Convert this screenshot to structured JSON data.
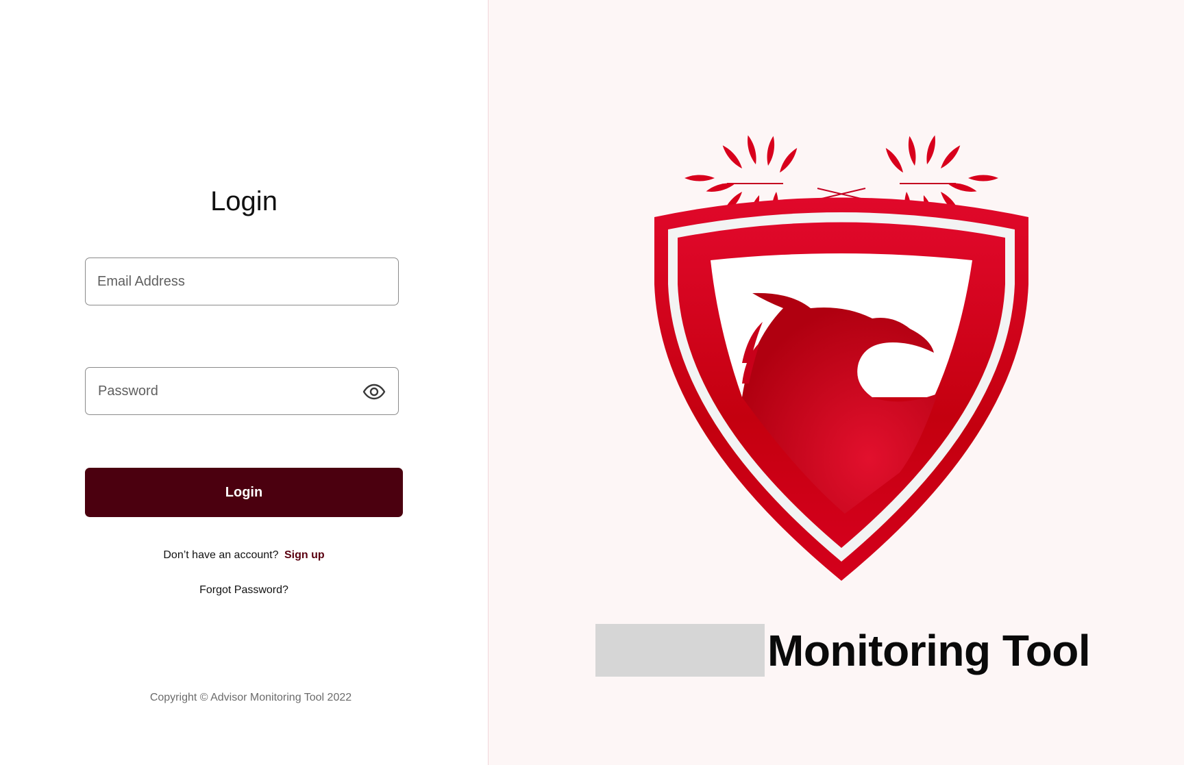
{
  "login": {
    "title": "Login",
    "email_placeholder": "Email Address",
    "password_placeholder": "Password",
    "submit_label": "Login",
    "signup_prompt": "Don’t have an account?",
    "signup_link": "Sign up",
    "forgot_link": "Forgot Password?",
    "copyright": "Copyright © Advisor Monitoring Tool 2022"
  },
  "brand": {
    "title": "Monitoring Tool",
    "logo_icon": "eagle-shield-laurel-logo",
    "accent_color": "#d6001c",
    "button_color": "#4b000f"
  },
  "icons": {
    "password_toggle": "eye-icon"
  }
}
